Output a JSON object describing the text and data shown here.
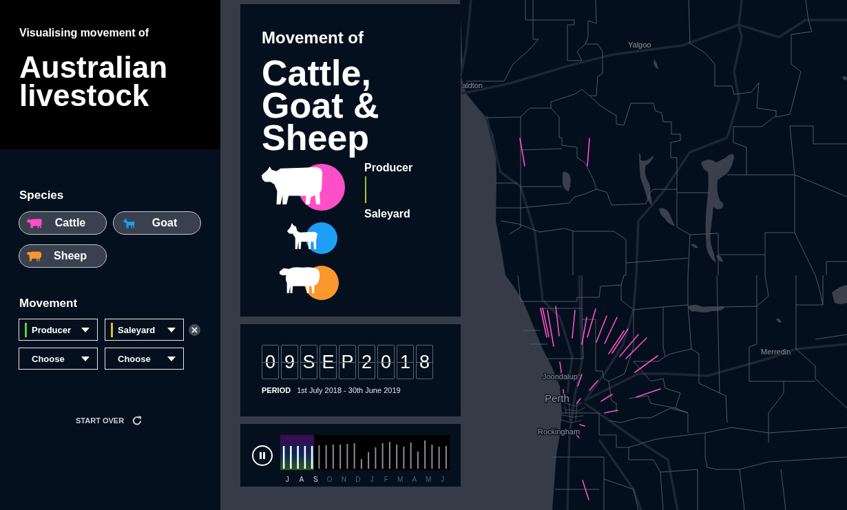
{
  "sidebar": {
    "subtitle": "Visualising movement of",
    "title": "Australian livestock",
    "species_heading": "Species",
    "species": [
      {
        "label": "Cattle",
        "kind": "cattle",
        "color": "#ff4fc6"
      },
      {
        "label": "Goat",
        "kind": "goat",
        "color": "#1e9ef5"
      },
      {
        "label": "Sheep",
        "kind": "sheep",
        "color": "#fb972d"
      }
    ],
    "movement_heading": "Movement",
    "movements": [
      {
        "from": {
          "value": "Producer",
          "color": "#5ad12b"
        },
        "to": {
          "value": "Saleyard",
          "color": "#f5b52a"
        },
        "removable": true
      },
      {
        "from": {
          "placeholder": "Choose"
        },
        "to": {
          "placeholder": "Choose"
        },
        "removable": false
      }
    ],
    "start_over": "START OVER"
  },
  "summary_card": {
    "heading": "Movement of",
    "title": "Cattle, Goat & Sheep",
    "legend_from": "Producer",
    "legend_to": "Saleyard"
  },
  "date_card": {
    "date_digits": [
      "0",
      "9",
      "S",
      "E",
      "P",
      "2",
      "0",
      "1",
      "8"
    ],
    "period_label": "PERIOD",
    "period": "1st July 2018 - 30th June 2019"
  },
  "timeline": {
    "playing": true,
    "level": 0.2,
    "months": [
      {
        "label": "J",
        "active": true
      },
      {
        "label": "A",
        "active": true
      },
      {
        "label": "S",
        "active": true
      },
      {
        "label": "O",
        "active": false
      },
      {
        "label": "N",
        "active": false
      },
      {
        "label": "D",
        "active": false
      },
      {
        "label": "J",
        "active": false
      },
      {
        "label": "F",
        "active": false
      },
      {
        "label": "M",
        "active": false
      },
      {
        "label": "A",
        "active": false
      },
      {
        "label": "M",
        "active": false
      },
      {
        "label": "J",
        "active": false
      }
    ]
  },
  "map": {
    "places": [
      {
        "name": "Yalgoo"
      },
      {
        "name": "aldton"
      },
      {
        "name": "Joondalup"
      },
      {
        "name": "Perth"
      },
      {
        "name": "Rockingham"
      },
      {
        "name": "Merredin"
      }
    ]
  }
}
